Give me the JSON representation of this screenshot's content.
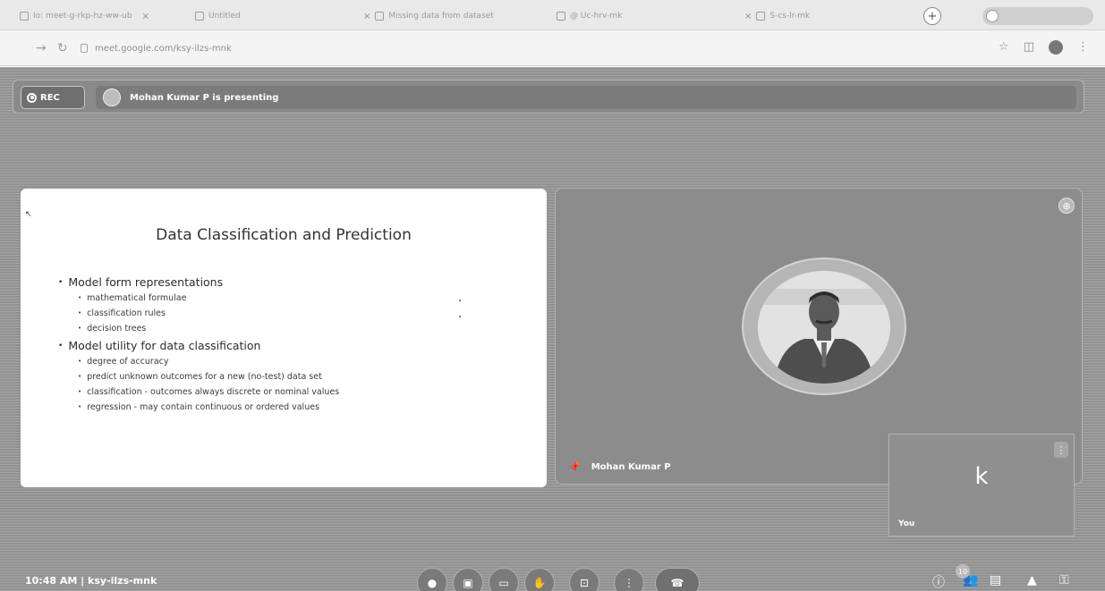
{
  "browser": {
    "tabs": [
      {
        "label": "Io: meet-g-rkp-hz-ww-ub",
        "active": false
      },
      {
        "label": "Untitled",
        "active": false
      },
      {
        "label": "Missing data from dataset",
        "active": false
      },
      {
        "label": "@ Uc-hrv-mk",
        "active": true
      },
      {
        "label": "S-cs-lr-mk",
        "active": false
      }
    ],
    "url": "meet.google.com/ksy-ilzs-mnk",
    "new_tab_label": "+"
  },
  "meet": {
    "rec_label": "REC",
    "presenting_text": "Mohan Kumar P is presenting",
    "presenter_name": "Mohan Kumar P",
    "self_initial": "k",
    "self_label": "You",
    "clock": "10:48 AM",
    "meeting_code": "ksy-ilzs-mnk",
    "participant_count": "10"
  },
  "slide": {
    "title": "Data Classification and Prediction",
    "sections": [
      {
        "heading": "Model form representations",
        "items": [
          "mathematical formulae",
          "classification rules",
          "decision trees"
        ]
      },
      {
        "heading": "Model utility for data classification",
        "items": [
          "degree of accuracy",
          "predict unknown outcomes for a new (no-test) data set",
          "classification - outcomes always discrete or nominal values",
          "regression - may contain continuous or ordered values"
        ]
      }
    ]
  },
  "icons": {
    "back": "back-arrow-icon",
    "reload": "reload-icon",
    "star": "star-icon",
    "extensions": "extensions-icon",
    "pin": "pin-icon"
  }
}
